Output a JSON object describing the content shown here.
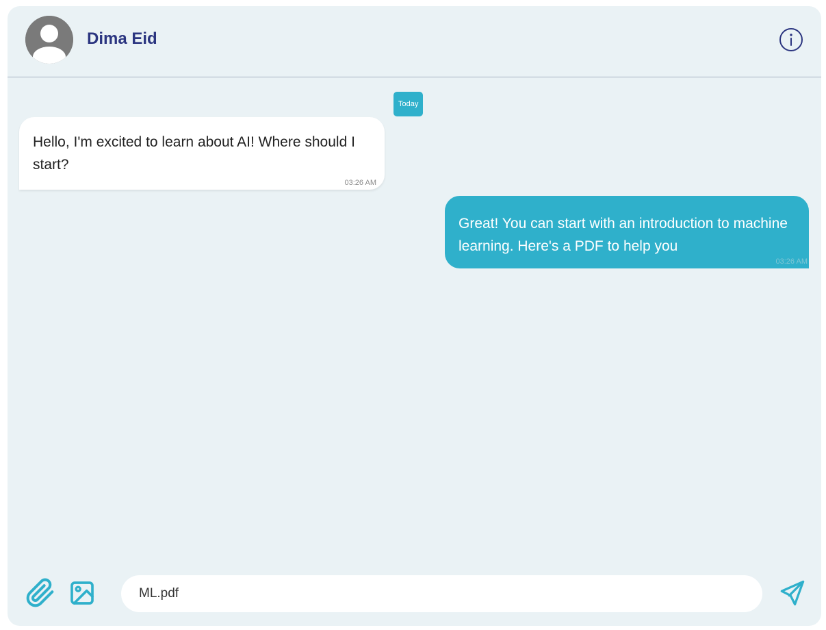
{
  "header": {
    "contact_name": "Dima Eid"
  },
  "messages": {
    "date_label": "Today",
    "items": [
      {
        "direction": "incoming",
        "text": "Hello, I'm excited to learn about AI! Where should I start?",
        "time": "03:26 AM"
      },
      {
        "direction": "outgoing",
        "text": "Great! You can start with an introduction to machine learning. Here's a PDF to help you",
        "time": "03:26 AM"
      }
    ]
  },
  "composer": {
    "input_value": "ML.pdf"
  },
  "icons": {
    "avatar": "user-avatar-icon",
    "info": "info-icon",
    "attach": "paperclip-icon",
    "image": "image-icon",
    "send": "send-icon"
  },
  "colors": {
    "accent": "#2fb0cb",
    "name": "#2b3580",
    "background": "#eaf2f5",
    "icon": "#2fb0cb"
  }
}
